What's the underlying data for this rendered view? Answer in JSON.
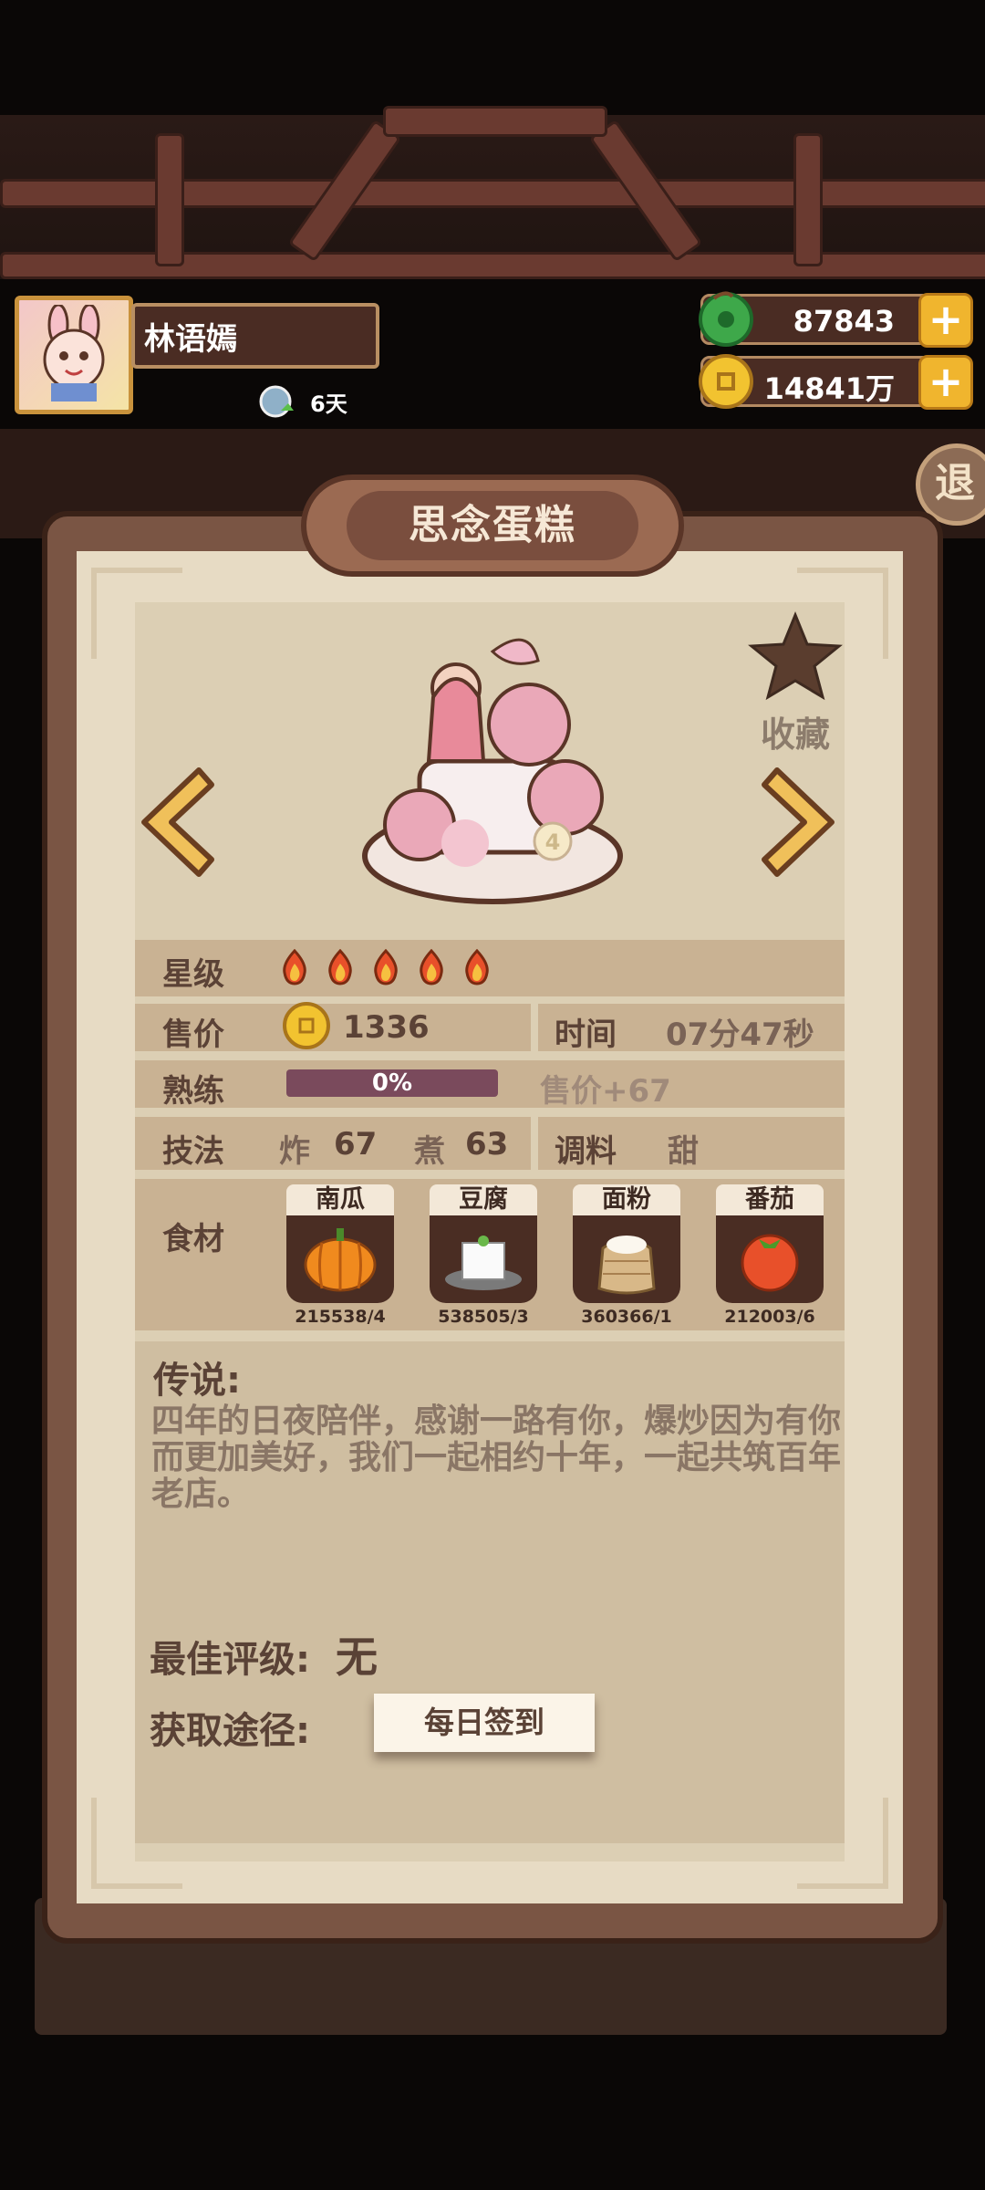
{
  "player": {
    "name": "林语嫣",
    "days": "6天"
  },
  "currency": {
    "jade": "87843",
    "coins": "14841万"
  },
  "exit_label": "退",
  "dish": {
    "title": "思念蛋糕",
    "favorite_label": "收藏",
    "cake_badge": "4",
    "star_label": "星级",
    "stars": 5,
    "price_label": "售价",
    "price": "1336",
    "time_label": "时间",
    "time": "07分47秒",
    "proficiency_label": "熟练",
    "proficiency": "0%",
    "proficiency_value": 0,
    "proficiency_bonus": "售价+67",
    "technique_label": "技法",
    "technique": [
      {
        "name": "炸",
        "value": "67"
      },
      {
        "name": "煮",
        "value": "63"
      }
    ],
    "seasoning_label": "调料",
    "seasoning": "甜",
    "ingredients_label": "食材",
    "ingredients": [
      {
        "name": "南瓜",
        "count": "215538/4",
        "icon": "pumpkin-icon"
      },
      {
        "name": "豆腐",
        "count": "538505/3",
        "icon": "tofu-icon"
      },
      {
        "name": "面粉",
        "count": "360366/1",
        "icon": "flour-sack-icon"
      },
      {
        "name": "番茄",
        "count": "212003/6",
        "icon": "tomato-icon"
      }
    ],
    "lore_title": "传说:",
    "lore_text": "四年的日夜陪伴，感谢一路有你，爆炒因为有你而更加美好，我们一起相约十年，一起共筑百年老店。",
    "best_rating_label": "最佳评级:",
    "best_rating": "无",
    "obtain_label": "获取途径:",
    "obtain_button": "每日签到"
  },
  "colors": {
    "panel": "#e7dbc4",
    "row": "#c9b293",
    "title": "#7a4e3e",
    "accent": "#f0b52e"
  }
}
